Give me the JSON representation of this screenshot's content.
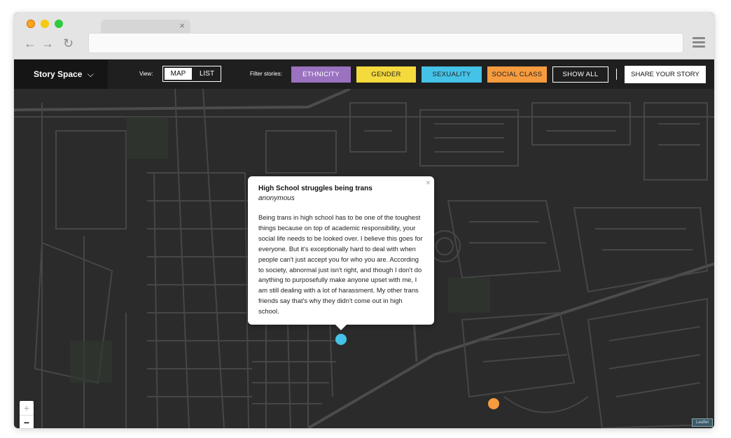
{
  "browser": {
    "tab_close": "×",
    "nav_back": "←",
    "nav_forward": "→",
    "nav_reload": "↻"
  },
  "header": {
    "brand": "Story Space",
    "brand_chevron": "⌵",
    "view_label": "View:",
    "view_options": [
      "MAP",
      "LIST"
    ],
    "view_selected": "MAP",
    "filter_label": "Filter stories:",
    "filters": [
      "ETHNICITY",
      "GENDER",
      "SEXUALITY",
      "SOCIAL CLASS"
    ],
    "show_all": "SHOW ALL",
    "share": "SHARE YOUR STORY"
  },
  "colors": {
    "ethnicity": "#9b72c0",
    "gender": "#f4da3c",
    "sexuality": "#45c2e8",
    "social_class": "#f69b3e",
    "map_background": "#2b2b2b"
  },
  "popup": {
    "close": "×",
    "title": "High School struggles being trans",
    "author": "anonymous",
    "body": "Being trans in high school has to be one of the toughest things because on top of academic responsibility, your social life needs to be looked over. I believe this goes for everyone. But it's exceptionally hard to deal with when people can't just accept you for who you are. According to society, abnormal just isn't right, and though I don't do anything to purposefully make anyone upset with me, I am still dealing with a lot of harassment. My other trans friends say that's why they didn't come out in high school."
  },
  "markers": [
    {
      "category": "sexuality",
      "color": "#45c2e8"
    },
    {
      "category": "social_class",
      "color": "#f69b3e"
    }
  ],
  "zoom": {
    "in": "+",
    "out": "−"
  },
  "attribution": "Leaflet"
}
